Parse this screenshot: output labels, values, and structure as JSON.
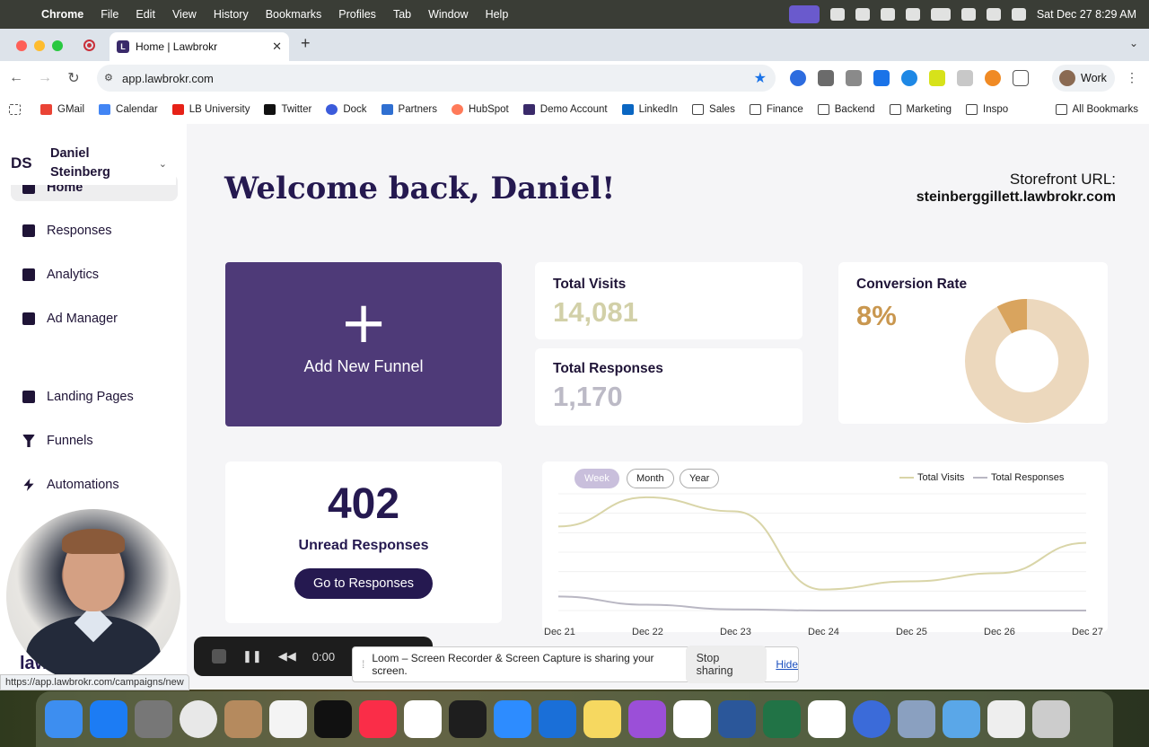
{
  "menubar": {
    "app": "Chrome",
    "items": [
      "File",
      "Edit",
      "View",
      "History",
      "Bookmarks",
      "Profiles",
      "Tab",
      "Window",
      "Help"
    ],
    "datetime": "Sat Dec 27  8:29 AM"
  },
  "browser": {
    "tab_title": "Home | Lawbrokr",
    "url": "app.lawbrokr.com",
    "profile": "Work",
    "bookmarks": [
      "GMail",
      "Calendar",
      "LB University",
      "Twitter",
      "Dock",
      "Partners",
      "HubSpot",
      "Demo Account",
      "LinkedIn",
      "Sales",
      "Finance",
      "Backend",
      "Marketing",
      "Inspo"
    ],
    "all_bookmarks": "All Bookmarks"
  },
  "sidebar": {
    "initials": "DS",
    "user_name": "Daniel Steinberg",
    "items": [
      {
        "label": "Home",
        "active": true
      },
      {
        "label": "Responses"
      },
      {
        "label": "Analytics"
      },
      {
        "label": "Ad Manager"
      },
      {
        "label": "Landing Pages"
      },
      {
        "label": "Funnels"
      },
      {
        "label": "Automations"
      }
    ]
  },
  "main": {
    "welcome": "Welcome back, Daniel!",
    "storefront_label": "Storefront URL:",
    "storefront_url": "steinberggillett.lawbrokr.com",
    "add_funnel": "Add New Funnel",
    "total_visits_label": "Total Visits",
    "total_visits": "14,081",
    "total_responses_label": "Total Responses",
    "total_responses": "1,170",
    "conversion_label": "Conversion Rate",
    "conversion_value": "8%",
    "unread_count": "402",
    "unread_label": "Unread Responses",
    "go_button": "Go to Responses"
  },
  "chart_data": {
    "type": "line",
    "x": [
      "Dec 21",
      "Dec 22",
      "Dec 23",
      "Dec 24",
      "Dec 25",
      "Dec 26",
      "Dec 27"
    ],
    "series": [
      {
        "name": "Total Visits",
        "values": [
          0.72,
          0.97,
          0.85,
          0.18,
          0.25,
          0.32,
          0.58
        ]
      },
      {
        "name": "Total Responses",
        "values": [
          0.12,
          0.05,
          0.01,
          0.0,
          0.0,
          0.0,
          0.0
        ]
      }
    ],
    "periods": [
      "Week",
      "Month",
      "Year"
    ],
    "selected_period": "Week",
    "colors": {
      "Total Visits": "#d9d5a8",
      "Total Responses": "#b9b7c3"
    }
  },
  "donut": {
    "value": 0.08,
    "colors": {
      "fill": "#d9a45e",
      "rest": "#ecd8bd"
    }
  },
  "overlays": {
    "status_url": "https://app.lawbrokr.com/campaigns/new",
    "timer": "0:00",
    "loom_text": "Loom – Screen Recorder & Screen Capture is sharing your screen.",
    "stop_sharing": "Stop sharing",
    "hide": "Hide",
    "brand_partial": "law"
  },
  "colors": {
    "brand": "#251950",
    "funnel": "#4e3a78"
  }
}
